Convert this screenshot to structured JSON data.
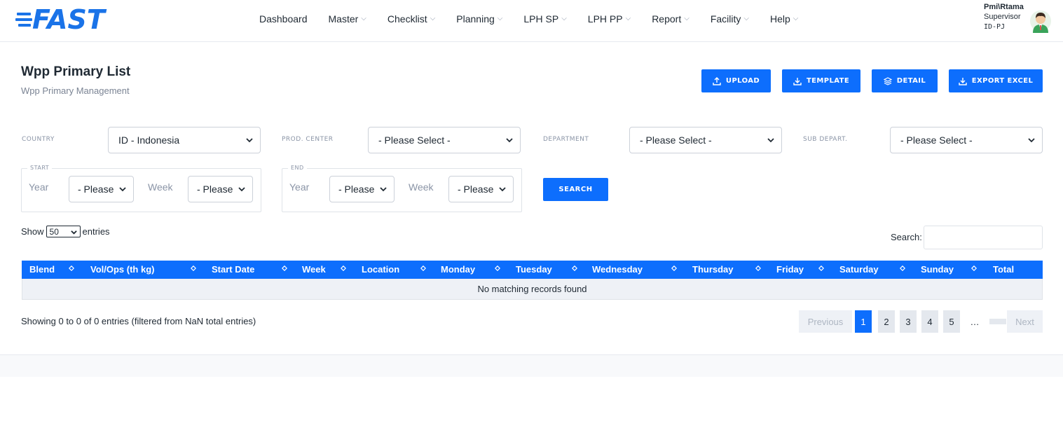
{
  "header": {
    "logo_text": "FAST",
    "nav": [
      {
        "label": "Dashboard",
        "has_menu": false
      },
      {
        "label": "Master",
        "has_menu": true
      },
      {
        "label": "Checklist",
        "has_menu": true
      },
      {
        "label": "Planning",
        "has_menu": true
      },
      {
        "label": "LPH SP",
        "has_menu": true
      },
      {
        "label": "LPH PP",
        "has_menu": true
      },
      {
        "label": "Report",
        "has_menu": true
      },
      {
        "label": "Facility",
        "has_menu": true
      },
      {
        "label": "Help",
        "has_menu": true
      }
    ],
    "user": {
      "name": "Pmi\\Rtama",
      "role": "Supervisor",
      "id": "ID-PJ"
    }
  },
  "page": {
    "title": "Wpp Primary List",
    "subtitle": "Wpp Primary Management"
  },
  "actions": {
    "upload": "UPLOAD",
    "template": "TEMPLATE",
    "detail": "DETAIL",
    "export": "EXPORT EXCEL"
  },
  "filters": {
    "country_label": "COUNTRY",
    "country_value": "ID - Indonesia",
    "prod_center_label": "PROD. CENTER",
    "prod_center_value": "- Please Select -",
    "department_label": "DEPARTMENT",
    "department_value": "- Please Select -",
    "sub_depart_label": "SUB DEPART.",
    "sub_depart_value": "- Please Select -",
    "start": {
      "legend": "START",
      "year_label": "Year",
      "year_value": "- Please",
      "week_label": "Week",
      "week_value": "- Please"
    },
    "end": {
      "legend": "END",
      "year_label": "Year",
      "year_value": "- Please",
      "week_label": "Week",
      "week_value": "- Please"
    },
    "search_button": "SEARCH"
  },
  "table_controls": {
    "show_prefix": "Show",
    "page_length": "50",
    "show_suffix": "entries",
    "search_label": "Search:"
  },
  "table": {
    "columns": [
      "Blend",
      "Vol/Ops (th kg)",
      "Start Date",
      "Week",
      "Location",
      "Monday",
      "Tuesday",
      "Wednesday",
      "Thursday",
      "Friday",
      "Saturday",
      "Sunday",
      "Total"
    ],
    "empty_message": "No matching records found"
  },
  "info_text": "Showing 0 to 0 of 0 entries (filtered from NaN total entries)",
  "pagination": {
    "previous": "Previous",
    "pages": [
      "1",
      "2",
      "3",
      "4",
      "5"
    ],
    "active": "1",
    "ellipsis": "…",
    "next": "Next"
  },
  "colors": {
    "primary": "#0d6efd",
    "logo": "#1a73e8"
  }
}
